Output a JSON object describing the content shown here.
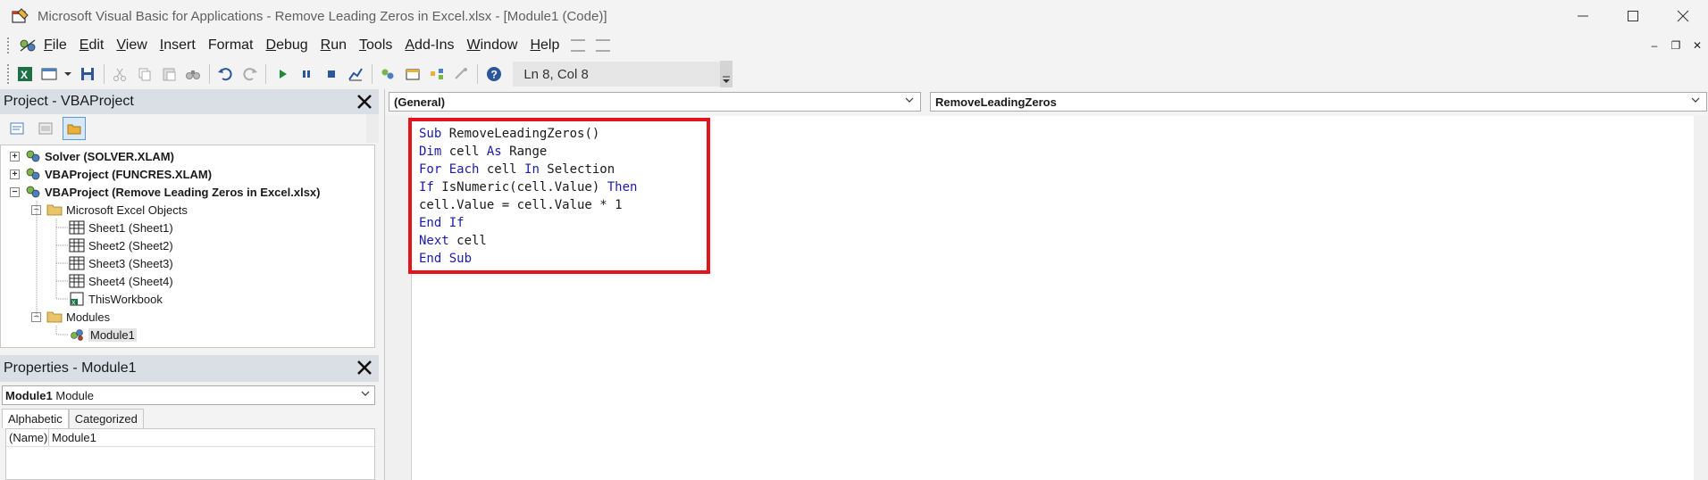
{
  "window": {
    "title": "Microsoft Visual Basic for Applications - Remove Leading Zeros in Excel.xlsx - [Module1 (Code)]",
    "minimize_glyph": "—",
    "maximize_glyph": "☐",
    "close_glyph": "✕"
  },
  "menu": {
    "items": [
      {
        "label": "File",
        "key": "F",
        "rest": "ile"
      },
      {
        "label": "Edit",
        "key": "E",
        "rest": "dit"
      },
      {
        "label": "View",
        "key": "V",
        "rest": "iew"
      },
      {
        "label": "Insert",
        "key": "I",
        "rest": "nsert"
      },
      {
        "label": "Format",
        "key": "F",
        "rest": "ormat",
        "pre": ""
      },
      {
        "label": "Debug",
        "key": "D",
        "rest": "ebug"
      },
      {
        "label": "Run",
        "key": "R",
        "rest": "un"
      },
      {
        "label": "Tools",
        "key": "T",
        "rest": "ools"
      },
      {
        "label": "Add-Ins",
        "key": "A",
        "rest": "dd-Ins"
      },
      {
        "label": "Window",
        "key": "W",
        "rest": "indow"
      },
      {
        "label": "Help",
        "key": "H",
        "rest": "elp"
      }
    ],
    "mdi_min": "–",
    "mdi_restore": "❐",
    "mdi_close": "✕"
  },
  "toolbar": {
    "position_text": "Ln 8, Col 8"
  },
  "project_pane": {
    "title": "Project - VBAProject",
    "close_glyph": "✕",
    "tree": [
      {
        "label": "Solver (SOLVER.XLAM)",
        "level": 0,
        "bold": true,
        "expander": "+"
      },
      {
        "label": "VBAProject (FUNCRES.XLAM)",
        "level": 0,
        "bold": true,
        "expander": "+"
      },
      {
        "label": "VBAProject (Remove Leading Zeros in Excel.xlsx)",
        "level": 0,
        "bold": true,
        "expander": "−"
      },
      {
        "label": "Microsoft Excel Objects",
        "level": 1,
        "bold": false,
        "expander": "−"
      },
      {
        "label": "Sheet1 (Sheet1)",
        "level": 2,
        "bold": false
      },
      {
        "label": "Sheet2 (Sheet2)",
        "level": 2,
        "bold": false
      },
      {
        "label": "Sheet3 (Sheet3)",
        "level": 2,
        "bold": false
      },
      {
        "label": "Sheet4 (Sheet4)",
        "level": 2,
        "bold": false
      },
      {
        "label": "ThisWorkbook",
        "level": 2,
        "bold": false
      },
      {
        "label": "Modules",
        "level": 1,
        "bold": false,
        "expander": "−"
      },
      {
        "label": "Module1",
        "level": 2,
        "bold": false,
        "selected": true
      }
    ]
  },
  "properties_pane": {
    "title": "Properties - Module1",
    "close_glyph": "✕",
    "object_name": "Module1",
    "object_type": "Module",
    "tabs": [
      "Alphabetic",
      "Categorized"
    ],
    "rows": [
      {
        "key": "(Name)",
        "value": "Module1"
      }
    ]
  },
  "code_window": {
    "object_combo": "(General)",
    "procedure_combo": "RemoveLeadingZeros",
    "lines": [
      [
        {
          "t": "Sub",
          "k": true
        },
        {
          "t": " RemoveLeadingZeros()",
          "k": false
        }
      ],
      [
        {
          "t": "Dim",
          "k": true
        },
        {
          "t": " cell ",
          "k": false
        },
        {
          "t": "As",
          "k": true
        },
        {
          "t": " Range",
          "k": false
        }
      ],
      [
        {
          "t": "For Each",
          "k": true
        },
        {
          "t": " cell ",
          "k": false
        },
        {
          "t": "In",
          "k": true
        },
        {
          "t": " Selection",
          "k": false
        }
      ],
      [
        {
          "t": "If",
          "k": true
        },
        {
          "t": " IsNumeric(cell.Value) ",
          "k": false
        },
        {
          "t": "Then",
          "k": true
        }
      ],
      [
        {
          "t": "cell.Value = cell.Value * 1",
          "k": false
        }
      ],
      [
        {
          "t": "End If",
          "k": true
        }
      ],
      [
        {
          "t": "Next",
          "k": true
        },
        {
          "t": " cell",
          "k": false
        }
      ],
      [
        {
          "t": "End Sub",
          "k": true
        }
      ]
    ]
  },
  "colors": {
    "keyword": "#1b1ba8",
    "highlight_border": "#e3141e",
    "pane_header": "#dadfe6"
  }
}
